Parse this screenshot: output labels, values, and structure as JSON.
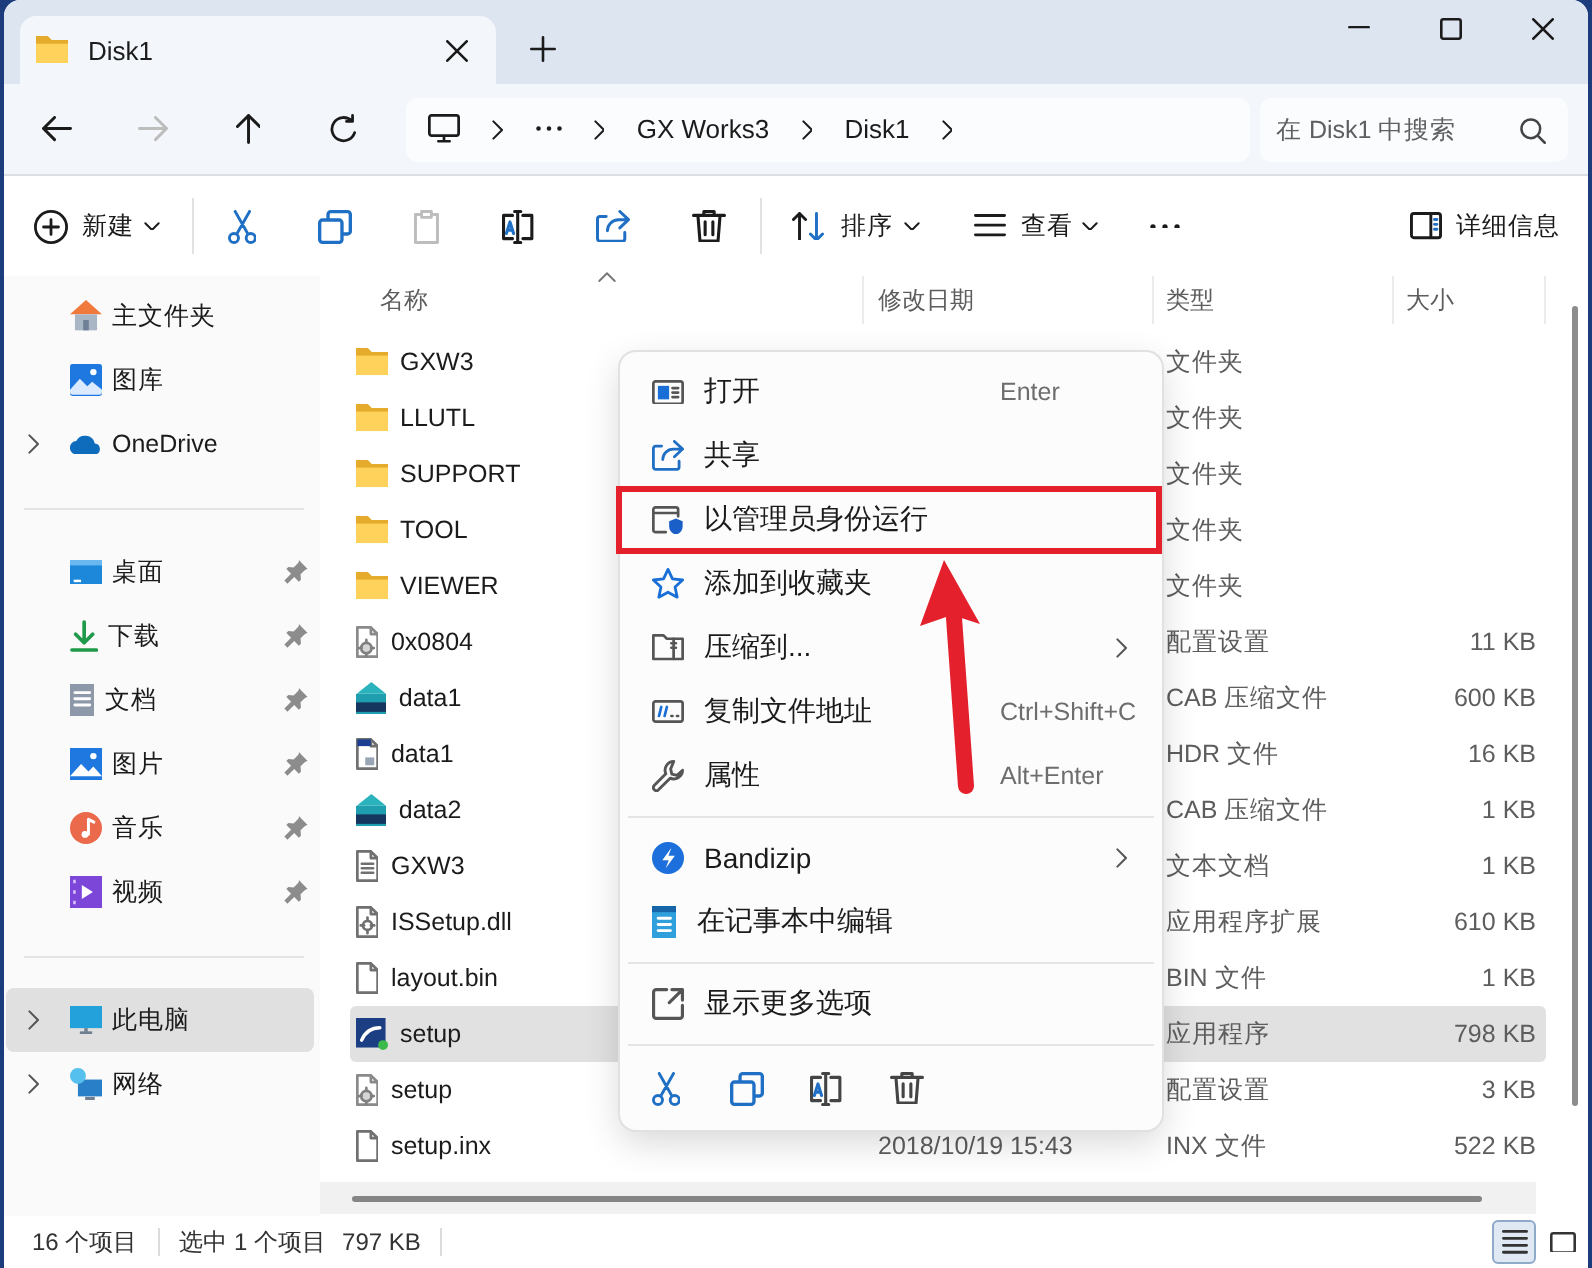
{
  "window": {
    "tab": {
      "title": "Disk1"
    }
  },
  "nav": [
    {
      "kind": "back",
      "disabled": false
    },
    {
      "kind": "forward",
      "disabled": true
    },
    {
      "kind": "up",
      "disabled": false
    },
    {
      "kind": "refresh",
      "disabled": false
    }
  ],
  "address": {
    "path": [
      {
        "kind": "computer"
      },
      {
        "kind": "overflow"
      },
      {
        "kind": "text",
        "label": "GX Works3"
      },
      {
        "kind": "text",
        "label": "Disk1"
      }
    ]
  },
  "search": {
    "placeholder": "在 Disk1 中搜索"
  },
  "toolbar": {
    "new": {
      "label": "新建"
    },
    "actions": [
      {
        "kind": "cut",
        "disabled": false
      },
      {
        "kind": "copy",
        "disabled": false
      },
      {
        "kind": "paste",
        "disabled": true
      },
      {
        "kind": "rename",
        "disabled": false
      },
      {
        "kind": "share",
        "disabled": false
      },
      {
        "kind": "delete",
        "disabled": false
      }
    ],
    "sort": {
      "label": "排序"
    },
    "view": {
      "label": "查看"
    },
    "details": {
      "label": "详细信息"
    }
  },
  "sidebar": {
    "groups": [
      {
        "items": [
          {
            "kind": "home",
            "label": "主文件夹",
            "expander": false,
            "pinned": false,
            "selected": false
          },
          {
            "kind": "gallery",
            "label": "图库",
            "expander": false,
            "pinned": false,
            "selected": false
          },
          {
            "kind": "cloud",
            "label": "OneDrive",
            "expander": true,
            "pinned": false,
            "selected": false
          }
        ]
      },
      {
        "items": [
          {
            "kind": "desktop",
            "label": "桌面",
            "expander": false,
            "pinned": true,
            "selected": false
          },
          {
            "kind": "download",
            "label": "下载",
            "expander": false,
            "pinned": true,
            "selected": false
          },
          {
            "kind": "documents",
            "label": "文档",
            "expander": false,
            "pinned": true,
            "selected": false
          },
          {
            "kind": "pictures",
            "label": "图片",
            "expander": false,
            "pinned": true,
            "selected": false
          },
          {
            "kind": "music",
            "label": "音乐",
            "expander": false,
            "pinned": true,
            "selected": false
          },
          {
            "kind": "videos",
            "label": "视频",
            "expander": false,
            "pinned": true,
            "selected": false
          }
        ]
      },
      {
        "items": [
          {
            "kind": "pc",
            "label": "此电脑",
            "expander": true,
            "pinned": false,
            "selected": true
          },
          {
            "kind": "network",
            "label": "网络",
            "expander": true,
            "pinned": false,
            "selected": false
          }
        ]
      }
    ]
  },
  "file_list": {
    "columns": [
      {
        "label": "名称",
        "sorted": true
      },
      {
        "label": "修改日期",
        "sorted": false
      },
      {
        "label": "类型",
        "sorted": false
      },
      {
        "label": "大小",
        "sorted": false
      }
    ],
    "rows": [
      {
        "kind": "folder",
        "name": "GXW3",
        "type": "文件夹",
        "selected": false
      },
      {
        "kind": "folder",
        "name": "LLUTL",
        "type": "文件夹",
        "selected": false
      },
      {
        "kind": "folder",
        "name": "SUPPORT",
        "type": "文件夹",
        "selected": false
      },
      {
        "kind": "folder",
        "name": "TOOL",
        "type": "文件夹",
        "selected": false
      },
      {
        "kind": "folder",
        "name": "VIEWER",
        "type": "文件夹",
        "selected": false
      },
      {
        "kind": "config",
        "name": "0x0804",
        "type": "配置设置",
        "size": "11 KB",
        "selected": false
      },
      {
        "kind": "cab",
        "name": "data1",
        "type": "CAB 压缩文件",
        "size": "600 KB",
        "selected": false
      },
      {
        "kind": "hdr",
        "name": "data1",
        "type": "HDR 文件",
        "size": "16 KB",
        "selected": false
      },
      {
        "kind": "cab",
        "name": "data2",
        "type": "CAB 压缩文件",
        "size": "1 KB",
        "selected": false
      },
      {
        "kind": "text",
        "name": "GXW3",
        "type": "文本文档",
        "size": "1 KB",
        "selected": false
      },
      {
        "kind": "dll",
        "name": "ISSetup.dll",
        "type": "应用程序扩展",
        "size": "610 KB",
        "selected": false
      },
      {
        "kind": "file",
        "name": "layout.bin",
        "type": "BIN 文件",
        "size": "1 KB",
        "selected": false
      },
      {
        "kind": "app",
        "name": "setup",
        "type": "应用程序",
        "size": "798 KB",
        "selected": true
      },
      {
        "kind": "config",
        "name": "setup",
        "type": "配置设置",
        "size": "3 KB",
        "selected": false
      },
      {
        "kind": "file",
        "name": "setup.inx",
        "modified": "2018/10/19 15:43",
        "type": "INX 文件",
        "size": "522 KB",
        "selected": false
      }
    ]
  },
  "context_menu": {
    "sections": [
      {
        "items": [
          {
            "kind": "open",
            "label": "打开",
            "shortcut": "Enter",
            "submenu": false,
            "highlighted": false
          },
          {
            "kind": "share",
            "label": "共享",
            "submenu": false,
            "highlighted": false
          },
          {
            "kind": "admin",
            "label": "以管理员身份运行",
            "submenu": false,
            "highlighted": true
          },
          {
            "kind": "star",
            "label": "添加到收藏夹",
            "submenu": false,
            "highlighted": false
          },
          {
            "kind": "zip",
            "label": "压缩到...",
            "submenu": true,
            "highlighted": false
          },
          {
            "kind": "copypath",
            "label": "复制文件地址",
            "shortcut": "Ctrl+Shift+C",
            "submenu": false,
            "highlighted": false
          },
          {
            "kind": "wrench",
            "label": "属性",
            "shortcut": "Alt+Enter",
            "submenu": false,
            "highlighted": false
          }
        ]
      },
      {
        "items": [
          {
            "kind": "bandizip",
            "label": "Bandizip",
            "submenu": true,
            "highlighted": false
          },
          {
            "kind": "notepad",
            "label": "在记事本中编辑",
            "submenu": false,
            "highlighted": false
          }
        ]
      },
      {
        "items": [
          {
            "kind": "moreopts",
            "label": "显示更多选项",
            "submenu": false,
            "highlighted": false
          }
        ]
      }
    ],
    "quick_actions": [
      {
        "kind": "cut"
      },
      {
        "kind": "copy"
      },
      {
        "kind": "rename"
      },
      {
        "kind": "delete"
      }
    ]
  },
  "status_bar": {
    "item_count": "16 个项目",
    "selection": "选中 1 个项目",
    "selection_size": "797 KB",
    "views": [
      {
        "kind": "details",
        "selected": true
      },
      {
        "kind": "tiles",
        "selected": false
      }
    ]
  }
}
